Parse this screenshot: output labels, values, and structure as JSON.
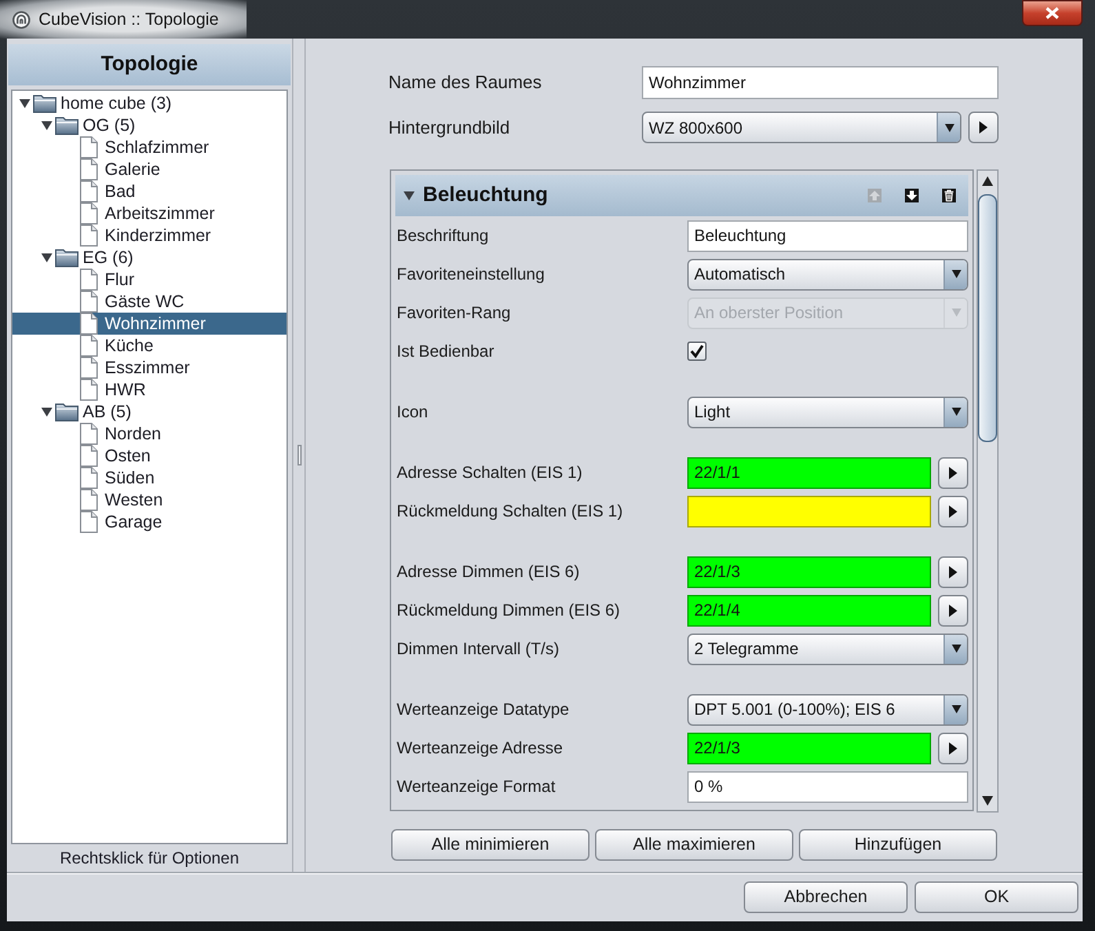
{
  "window": {
    "title": "CubeVision :: Topologie"
  },
  "sidebar": {
    "title": "Topologie",
    "tree": [
      {
        "kind": "folder",
        "label": "home cube (3)",
        "expanded": true,
        "selected": false,
        "children": [
          {
            "kind": "folder",
            "label": "OG (5)",
            "expanded": true,
            "selected": false,
            "children": [
              {
                "kind": "file",
                "label": "Schlafzimmer",
                "selected": false
              },
              {
                "kind": "file",
                "label": "Galerie",
                "selected": false
              },
              {
                "kind": "file",
                "label": "Bad",
                "selected": false
              },
              {
                "kind": "file",
                "label": "Arbeitszimmer",
                "selected": false
              },
              {
                "kind": "file",
                "label": "Kinderzimmer",
                "selected": false
              }
            ]
          },
          {
            "kind": "folder",
            "label": "EG (6)",
            "expanded": true,
            "selected": false,
            "children": [
              {
                "kind": "file",
                "label": "Flur",
                "selected": false
              },
              {
                "kind": "file",
                "label": "Gäste WC",
                "selected": false
              },
              {
                "kind": "file",
                "label": "Wohnzimmer",
                "selected": true
              },
              {
                "kind": "file",
                "label": "Küche",
                "selected": false
              },
              {
                "kind": "file",
                "label": "Esszimmer",
                "selected": false
              },
              {
                "kind": "file",
                "label": "HWR",
                "selected": false
              }
            ]
          },
          {
            "kind": "folder",
            "label": "AB (5)",
            "expanded": true,
            "selected": false,
            "children": [
              {
                "kind": "file",
                "label": "Norden",
                "selected": false
              },
              {
                "kind": "file",
                "label": "Osten",
                "selected": false
              },
              {
                "kind": "file",
                "label": "Süden",
                "selected": false
              },
              {
                "kind": "file",
                "label": "Westen",
                "selected": false
              },
              {
                "kind": "file",
                "label": "Garage",
                "selected": false
              }
            ]
          }
        ]
      }
    ],
    "hint": "Rechtsklick für Optionen"
  },
  "room": {
    "name": {
      "label": "Name des Raumes",
      "value": "Wohnzimmer"
    },
    "background_image": {
      "label": "Hintergrundbild",
      "value": "WZ 800x600"
    }
  },
  "section": {
    "title": "Beleuchtung",
    "expanded": true,
    "header_buttons": [
      {
        "kind": "move_up",
        "disabled": true
      },
      {
        "kind": "move_down",
        "disabled": false
      },
      {
        "kind": "delete",
        "disabled": false
      }
    ],
    "groups": [
      {
        "rows": [
          {
            "kind": "text",
            "label": "Beschriftung",
            "value": "Beleuchtung",
            "disabled": false
          },
          {
            "kind": "select",
            "label": "Favoriteneinstellung",
            "value": "Automatisch",
            "disabled": false
          },
          {
            "kind": "select",
            "label": "Favoriten-Rang",
            "value": "An oberster Position",
            "disabled": true
          },
          {
            "kind": "checkbox",
            "label": "Ist Bedienbar",
            "checked": true,
            "disabled": false
          }
        ]
      },
      {
        "rows": [
          {
            "kind": "select",
            "label": "Icon",
            "value": "Light",
            "disabled": false
          }
        ]
      },
      {
        "rows": [
          {
            "kind": "address",
            "label": "Adresse Schalten (EIS 1)",
            "value": "22/1/1",
            "color": "#00ff00",
            "disabled": false
          },
          {
            "kind": "address",
            "label": "Rückmeldung Schalten (EIS 1)",
            "color": "#ffff00",
            "disabled": false
          }
        ]
      },
      {
        "rows": [
          {
            "kind": "address",
            "label": "Adresse Dimmen (EIS 6)",
            "value": "22/1/3",
            "color": "#00ff00",
            "disabled": false
          },
          {
            "kind": "address",
            "label": "Rückmeldung Dimmen (EIS 6)",
            "value": "22/1/4",
            "color": "#00ff00",
            "disabled": false
          },
          {
            "kind": "select",
            "label": "Dimmen Intervall (T/s)",
            "value": "2 Telegramme",
            "disabled": false
          }
        ]
      },
      {
        "rows": [
          {
            "kind": "select",
            "label": "Werteanzeige Datatype",
            "value": "DPT 5.001 (0-100%); EIS 6",
            "disabled": false
          },
          {
            "kind": "address",
            "label": "Werteanzeige Adresse",
            "value": "22/1/3",
            "color": "#00ff00",
            "disabled": false
          },
          {
            "kind": "text",
            "label": "Werteanzeige Format",
            "value": "0 %",
            "disabled": false
          }
        ]
      }
    ]
  },
  "section_buttons": [
    "Alle minimieren",
    "Alle maximieren",
    "Hinzufügen"
  ],
  "dialog_buttons": [
    "Abbrechen",
    "OK"
  ]
}
